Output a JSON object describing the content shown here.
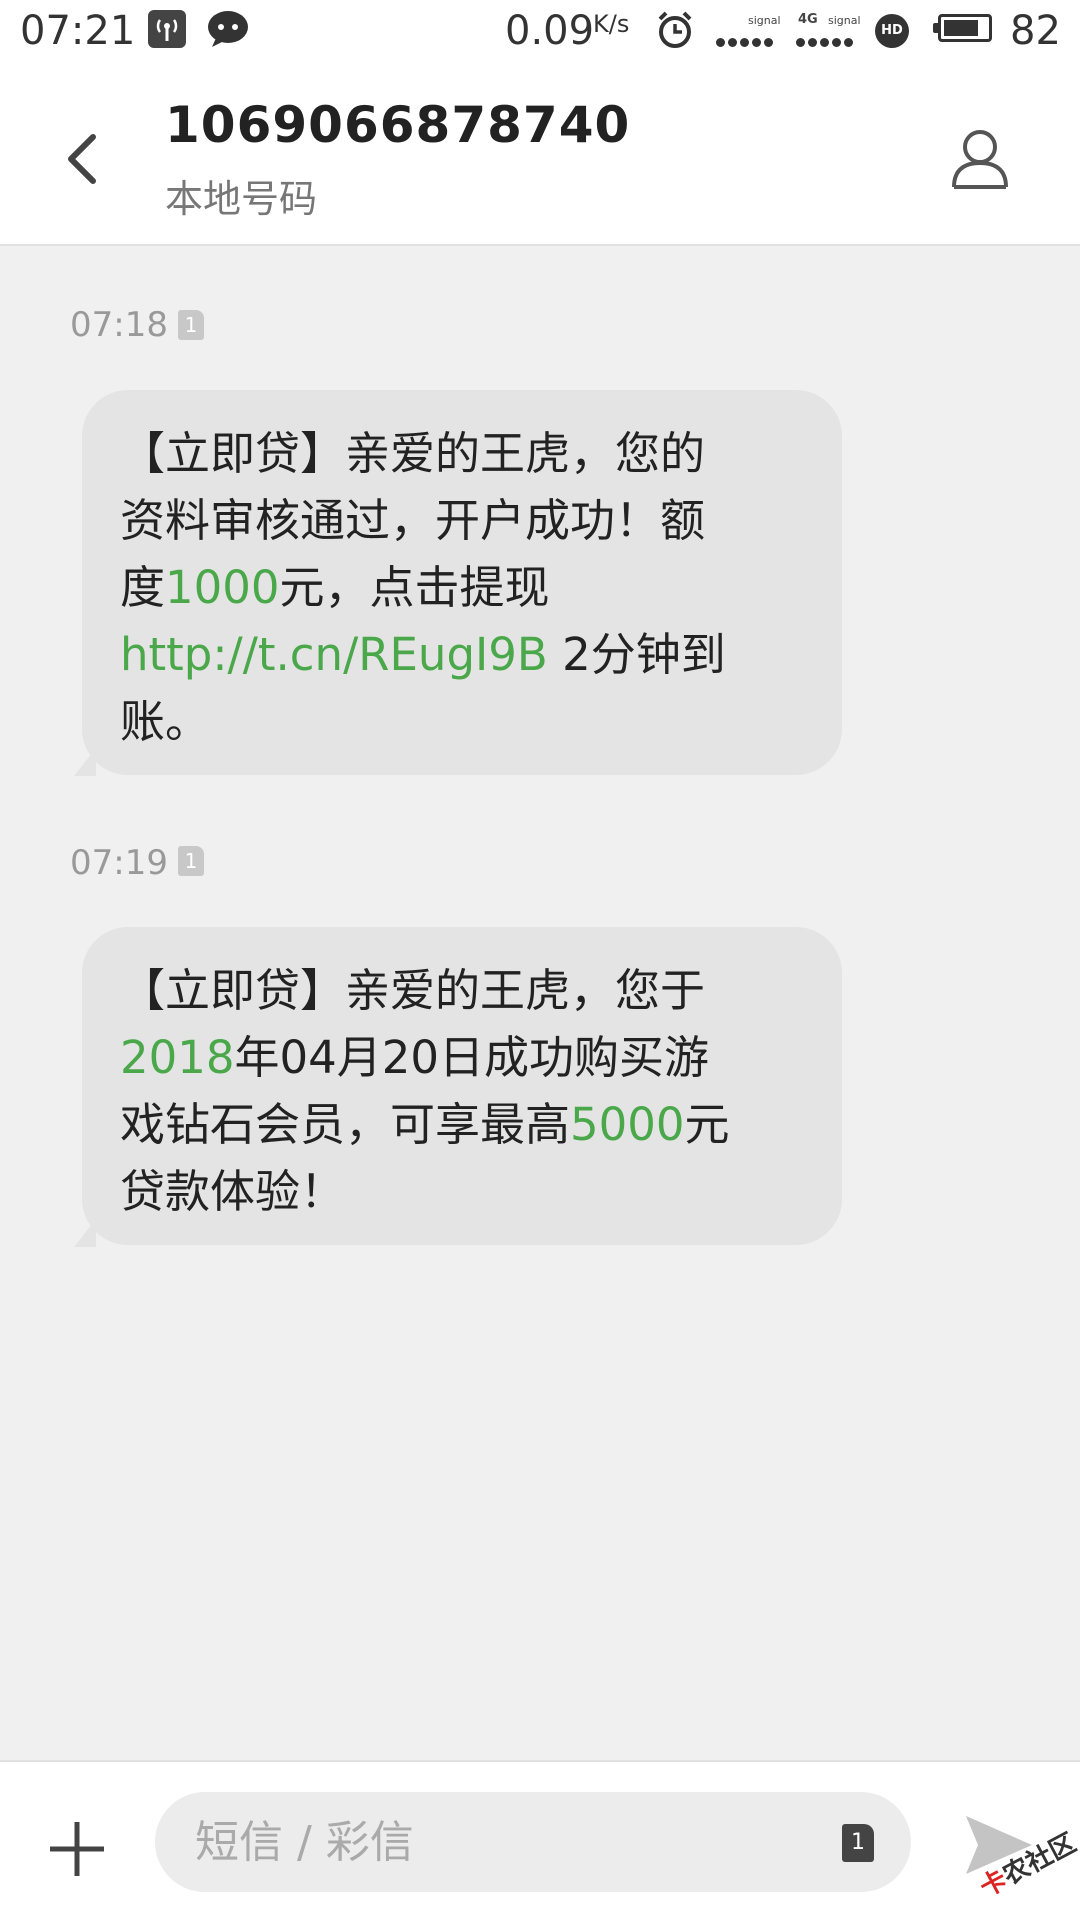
{
  "status_bar": {
    "time": "07:21",
    "net_speed": "0.09",
    "net_speed_unit": "K/s",
    "sim1_label": "signal",
    "network_type": "4G",
    "sim2_label": "signal",
    "volte_badge": "HD",
    "battery_level": "82",
    "battery_fraction": 0.82,
    "icons": [
      "wifi-hotspot-icon",
      "chat-bubble-icon",
      "alarm-icon",
      "signal-icon",
      "battery-icon"
    ]
  },
  "header": {
    "title": "1069066878740",
    "subtitle": "本地号码",
    "icons": [
      "back-arrow-icon",
      "contact-person-icon"
    ]
  },
  "messages": [
    {
      "time": "07:18",
      "sim": "1",
      "text_parts": [
        {
          "text": "【立即贷】亲爱的王虎，您的资料审核通过，开户成功！额度",
          "highlight": false
        },
        {
          "text": "1000",
          "highlight": true
        },
        {
          "text": "元，点击提现 ",
          "highlight": false
        },
        {
          "text": "http://t.cn/REugI9B",
          "highlight": true
        },
        {
          "text": " 2分钟到账。",
          "highlight": false
        }
      ]
    },
    {
      "time": "07:19",
      "sim": "1",
      "text_parts": [
        {
          "text": "【立即贷】亲爱的王虎，您于",
          "highlight": false
        },
        {
          "text": "2018",
          "highlight": true
        },
        {
          "text": "年04月20日成功购买游戏钻石会员，可享最高",
          "highlight": false
        },
        {
          "text": "5000",
          "highlight": true
        },
        {
          "text": "元贷款体验！",
          "highlight": false
        }
      ]
    }
  ],
  "composer": {
    "placeholder": "短信 / 彩信",
    "value": "",
    "sim": "1",
    "icons": [
      "plus-icon",
      "send-icon"
    ]
  },
  "watermark": {
    "prefix": "卡",
    "text": "农社区"
  },
  "colors": {
    "highlight": "#4aa84a",
    "bubble": "#e4e4e4",
    "background": "#f0f0f0"
  }
}
